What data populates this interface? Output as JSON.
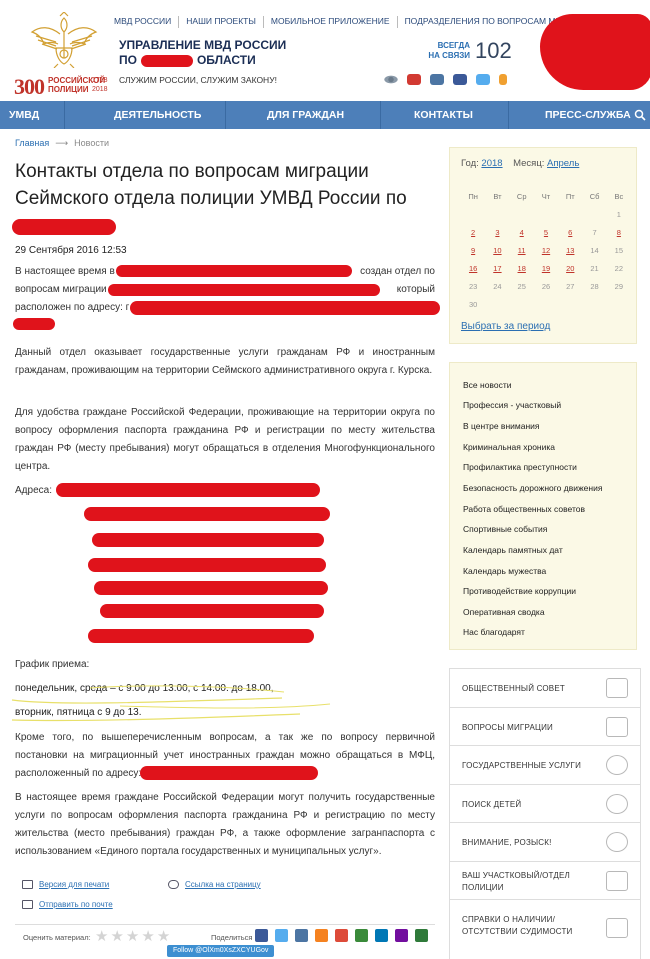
{
  "top_links": [
    "МВД РОССИИ",
    "НАШИ ПРОЕКТЫ",
    "МОБИЛЬНОЕ ПРИЛОЖЕНИЕ",
    "ПОДРАЗДЕЛЕНИЯ ПО ВОПРОСАМ МИГРАЦИИ"
  ],
  "logo": {
    "number": "300",
    "text_line1": "РОССИЙСКОЙ",
    "text_line2": "ПОЛИЦИИ",
    "year_from": "1718",
    "year_to": "2018"
  },
  "header": {
    "title_line1": "УПРАВЛЕНИЕ МВД РОССИИ",
    "title_line2_start": "ПО",
    "title_line2_end": "ОБЛАСТИ",
    "slogan": "СЛУЖИМ РОССИИ, СЛУЖИМ ЗАКОНУ!",
    "hotline_label_line1": "ВСЕГДА",
    "hotline_label_line2": "НА СВЯЗИ",
    "hotline_number": "102"
  },
  "social_icons": [
    "eye-icon",
    "youtube-icon",
    "vk-icon",
    "facebook-icon",
    "twitter-icon",
    "odnoklassniki-icon"
  ],
  "nav": [
    "УМВД",
    "ДЕЯТЕЛЬНОСТЬ",
    "ДЛЯ ГРАЖДАН",
    "КОНТАКТЫ",
    "ПРЕСС-СЛУЖБА"
  ],
  "breadcrumb": {
    "home": "Главная",
    "current": "Новости"
  },
  "article": {
    "title": "Контакты отдела по вопросам миграции Сеймского отдела полиции УМВД России по",
    "date": "29 Сентября 2016 12:53",
    "p1_a": "В настоящее время в",
    "p1_b": "создан отдел по",
    "p1_c": "вопросам миграции С",
    "p1_d": "который",
    "p1_e": "расположен по адресу: г",
    "p2": "Данный отдел оказывает государственные услуги гражданам РФ и иностранным гражданам, проживающим на территории Сеймского административного округа г. Курска.",
    "p3": "Для удобства  граждане Российской Федерации, проживающие на территории округа по вопросу оформления паспорта гражданина РФ и регистрации по месту жительства граждан РФ (месту пребывания) могут обращаться в отделения Многофункционального центра.",
    "address_label": "Адреса:",
    "schedule_label": "График приема:",
    "schedule_line1": "понедельник, среда  – с 9.00  до 13.00, с 14.00. до 18.00,",
    "schedule_line2": "вторник, пятница с 9 до 13.",
    "p4": "Кроме того, по вышеперечисленным вопросам, а так же по вопросу первичной постановки на миграционный учет иностранных граждан можно обращаться в МФЦ, расположенный по адресу:",
    "p5": "В настоящее время граждане Российской Федерации могут получить государственные услуги по вопросам оформления паспорта гражданина РФ и регистрацию по месту жительства (место пребывания)  граждан РФ, а также оформление загранпаспорта с использованием «Единого портала  государственных и муниципальных услуг»."
  },
  "article_tools": {
    "print": "Версия для печати",
    "link": "Ссылка на страницу",
    "mail": "Отправить по почте"
  },
  "rating": {
    "label": "Оценить материал:",
    "stars": 5,
    "share_label": "Поделиться",
    "follow": "Follow @OlXm0XsZXCYUGov"
  },
  "share_icons": [
    {
      "name": "facebook-icon",
      "color": "#3b5998"
    },
    {
      "name": "twitter-icon",
      "color": "#55acee"
    },
    {
      "name": "vk-icon",
      "color": "#4c75a3"
    },
    {
      "name": "odnoklassniki-icon",
      "color": "#f58220"
    },
    {
      "name": "google-plus-icon",
      "color": "#dd4b39"
    },
    {
      "name": "livejournal-icon",
      "color": "#3a8a3a"
    },
    {
      "name": "linkedin-icon",
      "color": "#0077b5"
    },
    {
      "name": "yahoo-icon",
      "color": "#720e9e"
    },
    {
      "name": "email-icon",
      "color": "#2f7a3a"
    }
  ],
  "calendar": {
    "year_label": "Год:",
    "year": "2018",
    "month_label": "Месяц:",
    "month": "Апрель",
    "weekdays": [
      "Пн",
      "Вт",
      "Ср",
      "Чт",
      "Пт",
      "Сб",
      "Вс"
    ],
    "weeks": [
      [
        "",
        "",
        "",
        "",
        "",
        "",
        "1"
      ],
      [
        "2",
        "3",
        "4",
        "5",
        "6",
        "7",
        "8"
      ],
      [
        "9",
        "10",
        "11",
        "12",
        "13",
        "14",
        "15"
      ],
      [
        "16",
        "17",
        "18",
        "19",
        "20",
        "21",
        "22"
      ],
      [
        "23",
        "24",
        "25",
        "26",
        "27",
        "28",
        "29"
      ],
      [
        "30",
        "",
        "",
        "",
        "",
        "",
        ""
      ]
    ],
    "linked_days": [
      "2",
      "3",
      "4",
      "5",
      "6",
      "8",
      "9",
      "10",
      "11",
      "12",
      "13",
      "16",
      "17",
      "18",
      "19",
      "20"
    ],
    "period_link": "Выбрать за период"
  },
  "news_categories": [
    "Все новости",
    "Профессия - участковый",
    "В центре внимания",
    "Криминальная хроника",
    "Профилактика преступности",
    "Безопасность дорожного движения",
    "Работа общественных советов",
    "Спортивные события",
    "Календарь памятных дат",
    "Календарь мужества",
    "Противодействие коррупции",
    "Оперативная сводка",
    "Нас благодарят"
  ],
  "services": [
    {
      "label": "ОБЩЕСТВЕННЫЙ СОВЕТ",
      "icon": "document-icon"
    },
    {
      "label": "ВОПРОСЫ МИГРАЦИИ",
      "icon": "passport-icon"
    },
    {
      "label": "ГОСУДАРСТВЕННЫЕ УСЛУГИ",
      "icon": "gosuslugi-icon"
    },
    {
      "label": "ПОИСК ДЕТЕЙ",
      "icon": "child-icon"
    },
    {
      "label": "ВНИМАНИЕ, РОЗЫСК!",
      "icon": "magnifier-icon"
    },
    {
      "label": "ВАШ УЧАСТКОВЫЙ/ОТДЕЛ ПОЛИЦИИ",
      "icon": "police-cap-icon"
    },
    {
      "label": "СПРАВКИ О НАЛИЧИИ/ ОТСУТСТВИИ СУДИМОСТИ",
      "icon": "certificate-icon"
    }
  ],
  "colors": {
    "nav_bg": "#4d7fb9",
    "link": "#2b6fb2",
    "redaction": "#e0131b",
    "sidebar_bg": "#fbf9e6",
    "brand_red": "#c0332a"
  }
}
